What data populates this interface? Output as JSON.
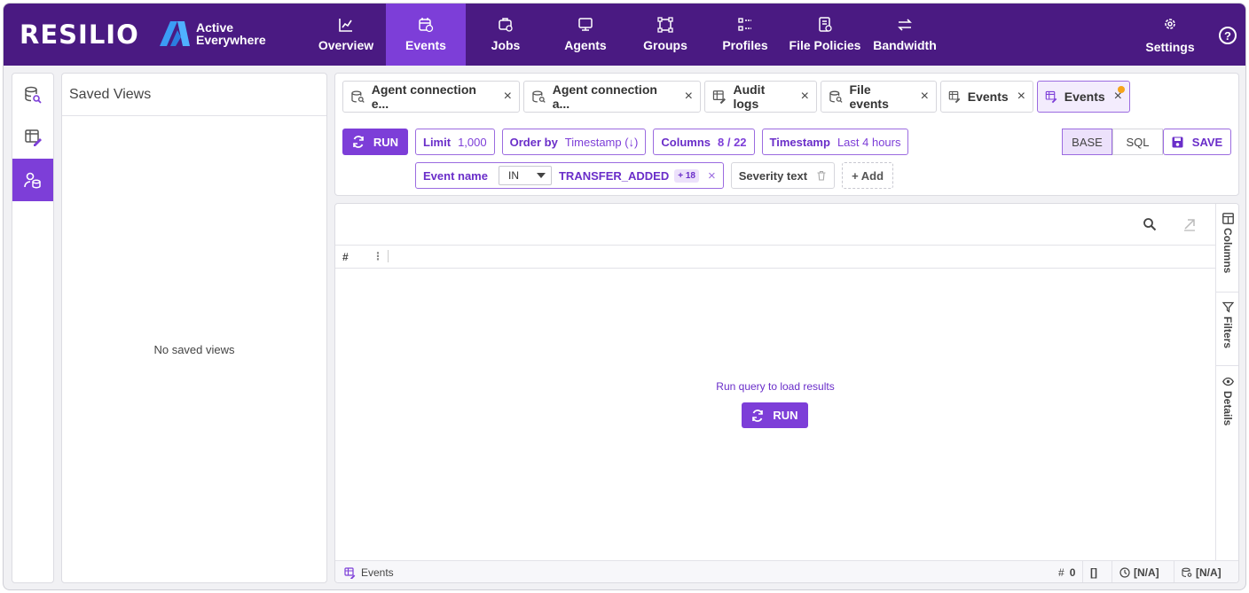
{
  "brand": {
    "name": "RESILIO",
    "product_line1": "Active",
    "product_line2": "Everywhere"
  },
  "nav": [
    {
      "label": "Overview",
      "icon": "chart-icon"
    },
    {
      "label": "Events",
      "icon": "calendar-clock-icon",
      "active": true
    },
    {
      "label": "Jobs",
      "icon": "jobs-icon"
    },
    {
      "label": "Agents",
      "icon": "agents-icon"
    },
    {
      "label": "Groups",
      "icon": "groups-icon"
    },
    {
      "label": "Profiles",
      "icon": "profiles-icon"
    },
    {
      "label": "File Policies",
      "icon": "file-policies-icon"
    },
    {
      "label": "Bandwidth",
      "icon": "bandwidth-icon"
    }
  ],
  "settings_label": "Settings",
  "help_label": "?",
  "saved_views": {
    "title": "Saved Views",
    "empty": "No saved views"
  },
  "tabs": [
    {
      "label": "Agent connection e...",
      "close": "×"
    },
    {
      "label": "Agent connection a...",
      "close": "×"
    },
    {
      "label": "Audit logs",
      "close": "×"
    },
    {
      "label": "File events",
      "close": "×"
    },
    {
      "label": "Events",
      "close": "×"
    },
    {
      "label": "Events",
      "close": "×"
    }
  ],
  "toolbar": {
    "run_label": "RUN",
    "limit_key": "Limit",
    "limit_value": "1,000",
    "order_key": "Order by",
    "order_value": "Timestamp (↓)",
    "columns_key": "Columns",
    "columns_value": "8 / 22",
    "timestamp_key": "Timestamp",
    "timestamp_value": "Last 4 hours",
    "mode_base": "BASE",
    "mode_sql": "SQL",
    "save_label": "SAVE"
  },
  "filters": {
    "event_name_key": "Event name",
    "operator": "IN",
    "value": "TRANSFER_ADDED",
    "extra_count": "+ 18",
    "remove": "×",
    "severity_label": "Severity text",
    "add_label": "+ Add"
  },
  "results": {
    "hash_col": "#",
    "kebab": "⋮",
    "empty_message": "Run query to load results",
    "run_label": "RUN",
    "side_tabs": [
      "Columns",
      "Filters",
      "Details"
    ]
  },
  "status": {
    "source": "Events",
    "count_prefix": "#",
    "count": "0",
    "brackets": "[]",
    "time_value": "[N/A]",
    "db_value": "[N/A]"
  },
  "colors": {
    "nav_bg": "#4a1a82",
    "accent": "#7d3ed8",
    "accent_text": "#6a2ec9",
    "dot": "#f5a31a"
  }
}
